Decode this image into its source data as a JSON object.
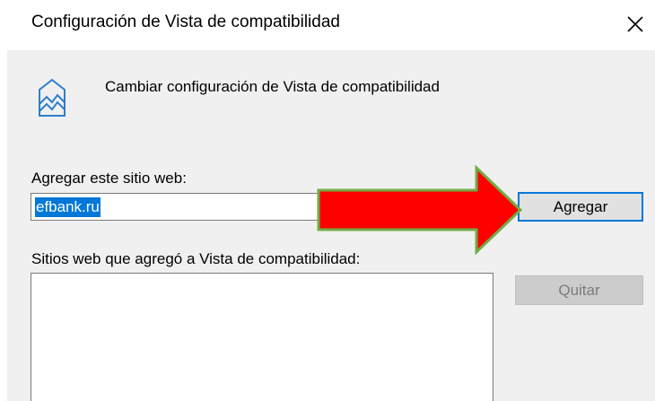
{
  "window": {
    "title": "Configuración de Vista de compatibilidad",
    "close_icon": "close-icon"
  },
  "header": {
    "icon": "compatibility-view-icon",
    "text": "Cambiar configuración de Vista de compatibilidad"
  },
  "add_site": {
    "label": "Agregar este sitio web:",
    "value": "efbank.ru",
    "button_label": "Agregar"
  },
  "sites_list": {
    "label": "Sitios web que agregó a Vista de compatibilidad:",
    "items": [],
    "remove_button_label": "Quitar"
  },
  "colors": {
    "accent": "#0078d7",
    "arrow": "#ff0000",
    "arrow_outline": "#70ad47",
    "panel": "#f0f0f0"
  }
}
